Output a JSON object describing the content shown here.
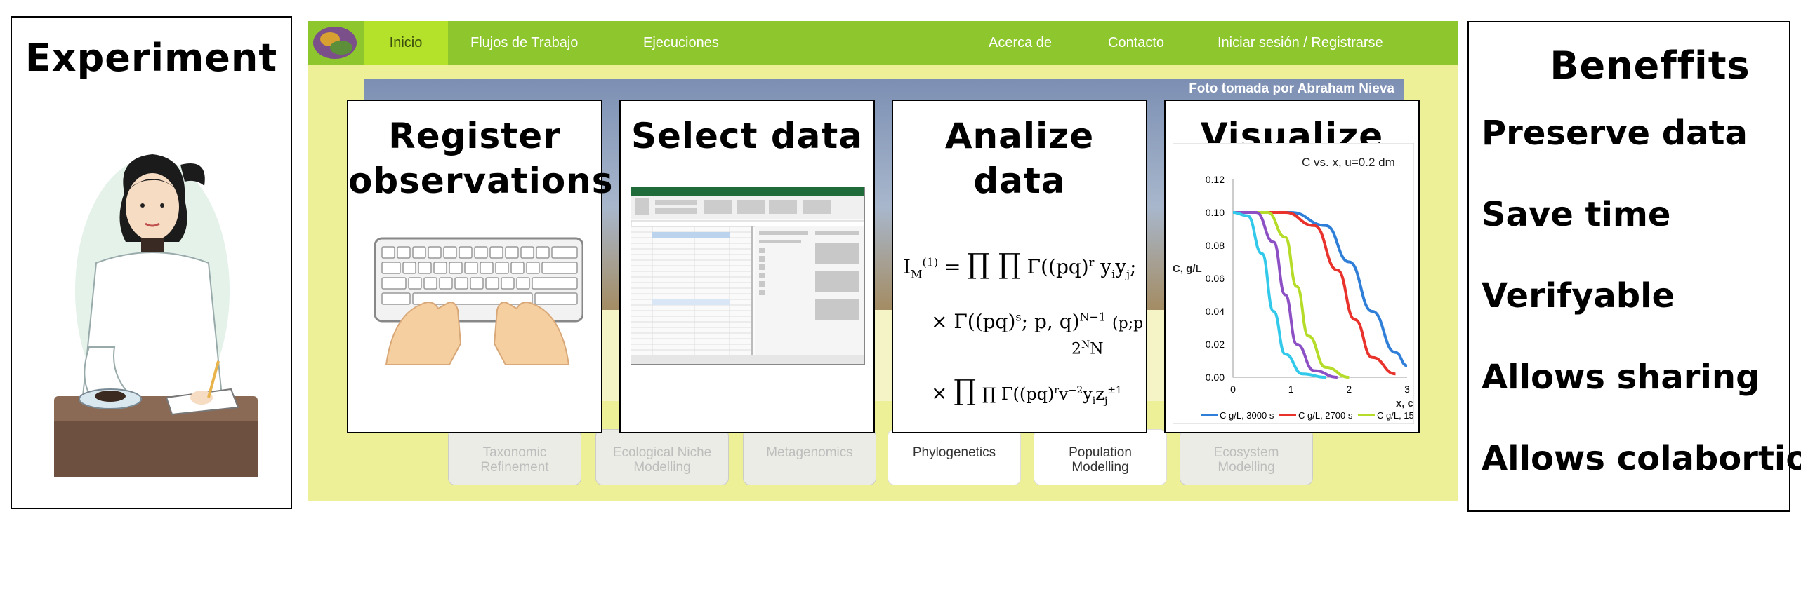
{
  "experiment": {
    "title": "Experiment"
  },
  "app": {
    "nav": {
      "home": "Inicio",
      "workflows": "Flujos de Trabajo",
      "runs": "Ejecuciones",
      "about": "Acerca de",
      "contact": "Contacto",
      "login": "Iniciar sesión / Registrarse"
    },
    "photo_credit": "Foto tomada por Abraham Nieva",
    "modules": [
      {
        "label": "Taxonomic\nRefinement"
      },
      {
        "label": "Ecological Niche\nModelling"
      },
      {
        "label": "Metagenomics"
      },
      {
        "label": "Phylogenetics"
      },
      {
        "label": "Population\nModelling"
      },
      {
        "label": "Ecosystem\nModelling"
      }
    ],
    "colors": {
      "navbar": "#8ec62d",
      "active_tab": "#b4e22b",
      "background": "#eef098"
    }
  },
  "steps": [
    {
      "title_line1": "Register",
      "title_line2": "observations"
    },
    {
      "title_line1": "Select data"
    },
    {
      "title_line1": "Analize",
      "title_line2": "data"
    },
    {
      "title_line1": "Visualize"
    }
  ],
  "benefits": {
    "title": "Beneffits",
    "items": [
      "Preserve data",
      "Save time",
      "Verifyable",
      "Allows sharing",
      "Allows colabortion"
    ]
  },
  "chart_data": {
    "type": "line",
    "title": "C vs. x, u=0.2 dm",
    "xlabel": "x, c",
    "ylabel": "C, g/L",
    "xlim": [
      0,
      3
    ],
    "ylim": [
      0,
      0.12
    ],
    "yticks": [
      "0.12",
      "0.10",
      "0.08",
      "0.06",
      "0.04",
      "0.02",
      "0.00"
    ],
    "xticks": [
      "0",
      "1",
      "2",
      "3"
    ],
    "series": [
      {
        "name": "C g/L, 3000 s",
        "color": "#2f7fd9",
        "x": [
          0,
          1,
          1.6,
          2.0,
          2.4,
          2.8,
          3.0
        ],
        "y": [
          0.1,
          0.1,
          0.092,
          0.07,
          0.04,
          0.015,
          0.007
        ]
      },
      {
        "name": "C g/L, 2700 s",
        "color": "#e8322b",
        "x": [
          0,
          0.9,
          1.4,
          1.8,
          2.1,
          2.4,
          2.8
        ],
        "y": [
          0.1,
          0.1,
          0.092,
          0.065,
          0.035,
          0.012,
          0.002
        ]
      },
      {
        "name": "C g/L, 15",
        "color": "#b5dc28",
        "x": [
          0,
          0.6,
          0.9,
          1.1,
          1.3,
          1.6,
          2.0
        ],
        "y": [
          0.1,
          0.1,
          0.085,
          0.055,
          0.025,
          0.006,
          0.0
        ]
      },
      {
        "name": "",
        "color": "#8c4fc4",
        "x": [
          0,
          0.4,
          0.7,
          0.9,
          1.1,
          1.4,
          1.8
        ],
        "y": [
          0.1,
          0.1,
          0.082,
          0.05,
          0.02,
          0.004,
          0.0
        ]
      },
      {
        "name": "",
        "color": "#33c9ea",
        "x": [
          0,
          0.25,
          0.5,
          0.7,
          0.9,
          1.2,
          1.6
        ],
        "y": [
          0.1,
          0.098,
          0.075,
          0.04,
          0.014,
          0.002,
          0.0
        ]
      }
    ]
  }
}
